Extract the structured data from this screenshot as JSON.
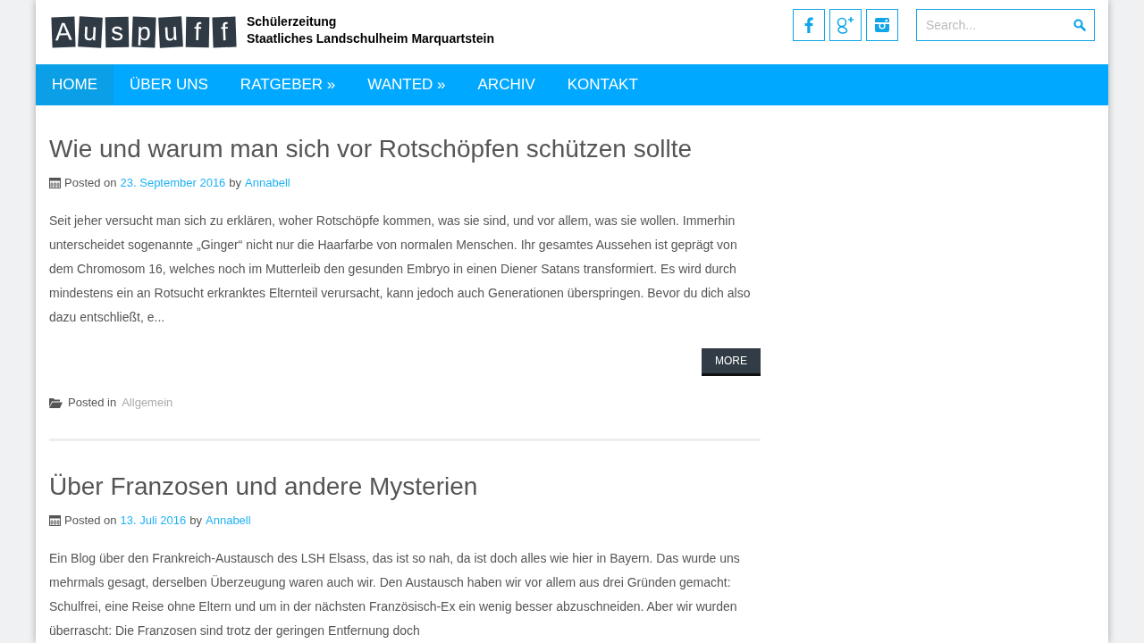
{
  "logo": {
    "letters": [
      "A",
      "u",
      "s",
      "p",
      "u",
      "f",
      "f"
    ],
    "lines": [
      "Schülerzeitung",
      "Staatliches Landschulheim Marquartstein"
    ]
  },
  "social": [
    {
      "kind": "facebook"
    },
    {
      "kind": "googleplus"
    },
    {
      "kind": "instagram"
    }
  ],
  "search": {
    "placeholder": "Search..."
  },
  "nav": [
    {
      "label": "HOME",
      "selected": true
    },
    {
      "label": "ÜBER UNS",
      "selected": false
    },
    {
      "label": "RATGEBER »",
      "selected": false
    },
    {
      "label": "WANTED »",
      "selected": false
    },
    {
      "label": "ARCHIV",
      "selected": false
    },
    {
      "label": "KONTAKT",
      "selected": false
    }
  ],
  "posts": [
    {
      "title": "Wie und warum man sich vor Rotschöpfen schützen sollte",
      "posted_on": "Posted on",
      "date": "23. September 2016",
      "by": "by",
      "author": "Annabell",
      "excerpt": "Seit jeher versucht man sich zu erklären, woher Rotschöpfe kommen, was sie sind, und vor allem, was sie wollen. Immerhin unterscheidet sogenannte „Ginger“ nicht nur die Haarfarbe von normalen Menschen. Ihr gesamtes Aussehen ist geprägt von dem Chromosom 16, welches noch im Mutterleib den gesunden Embryo in einen Diener Satans transformiert. Es wird durch mindestens ein an Rotsucht erkranktes Elternteil verursacht, kann jedoch auch Generationen überspringen. Bevor du dich also dazu entschließt, e...",
      "more": "MORE",
      "posted_in": "Posted in",
      "category": "Allgemein"
    },
    {
      "title": "Über Franzosen und andere Mysterien",
      "posted_on": "Posted on",
      "date": "13. Juli 2016",
      "by": "by",
      "author": "Annabell",
      "excerpt": "Ein Blog über den Frankreich-Austausch des LSH Elsass, das ist so nah, da ist doch alles wie hier in Bayern. Das wurde uns mehrmals gesagt, derselben Überzeugung waren auch wir. Den Austausch haben wir vor allem aus drei Gründen gemacht: Schulfrei, eine Reise ohne Eltern und um in der nächsten Französisch-Ex ein wenig besser abzuschneiden. Aber wir wurden überrascht: Die Franzosen sind trotz der geringen Entfernung doch"
    }
  ]
}
